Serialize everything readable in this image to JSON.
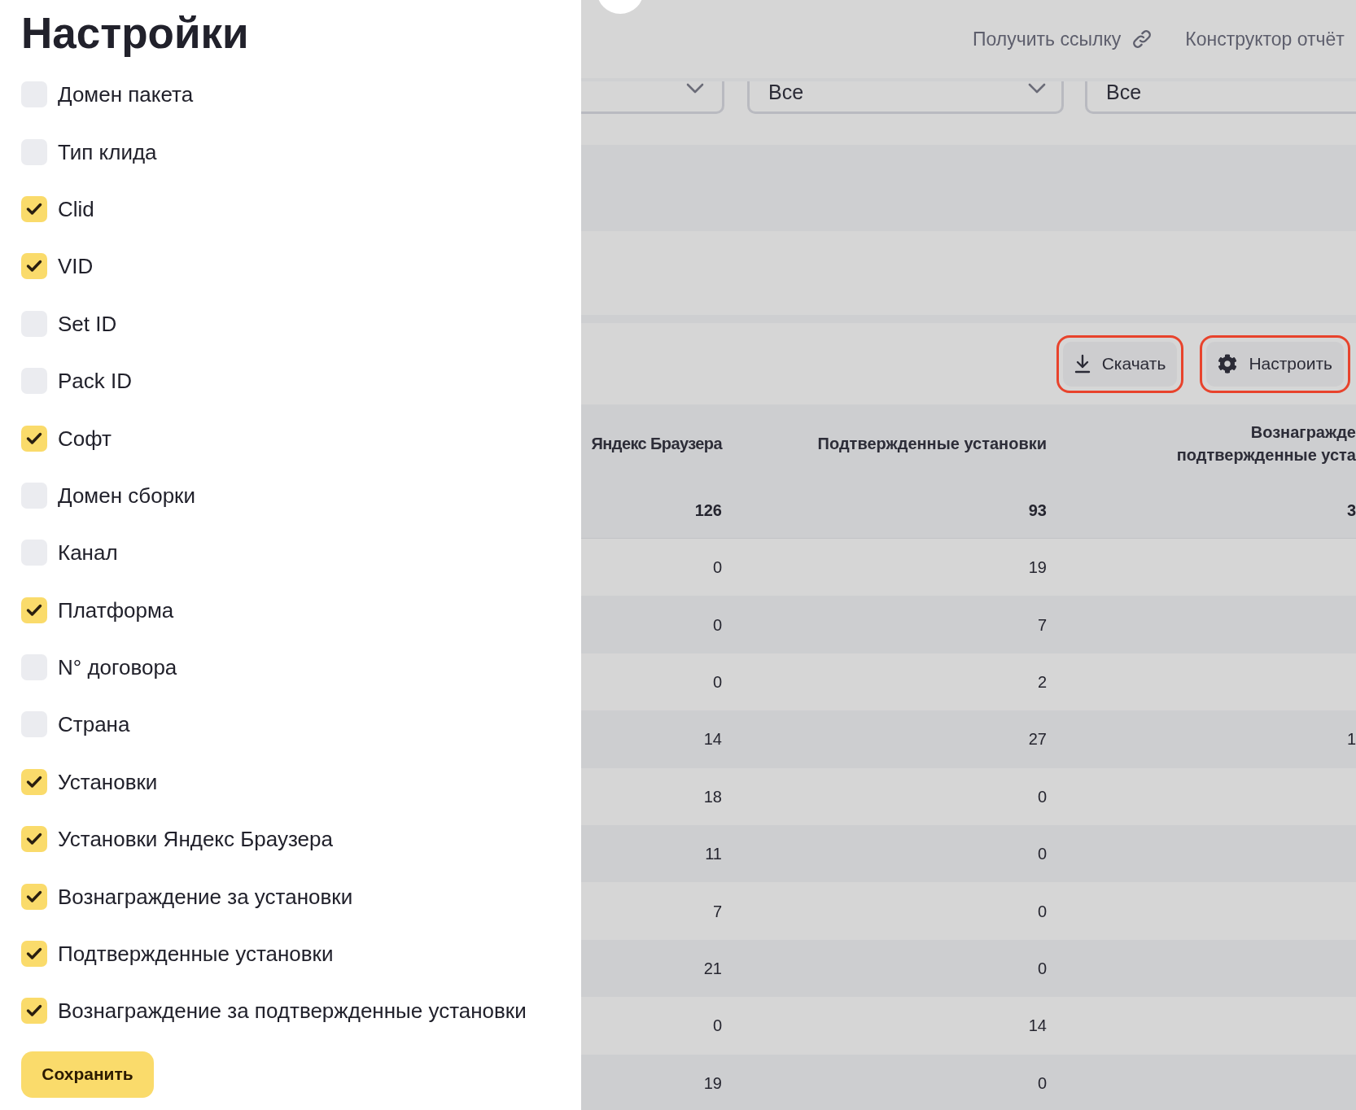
{
  "settings_panel": {
    "title": "Настройки",
    "options": [
      {
        "label": "Домен пакета",
        "checked": false
      },
      {
        "label": "Тип клида",
        "checked": false
      },
      {
        "label": "Clid",
        "checked": true
      },
      {
        "label": "VID",
        "checked": true
      },
      {
        "label": "Set ID",
        "checked": false
      },
      {
        "label": "Pack ID",
        "checked": false
      },
      {
        "label": "Софт",
        "checked": true
      },
      {
        "label": "Домен сборки",
        "checked": false
      },
      {
        "label": "Канал",
        "checked": false
      },
      {
        "label": "Платформа",
        "checked": true
      },
      {
        "label": "N° договора",
        "checked": false
      },
      {
        "label": "Страна",
        "checked": false
      },
      {
        "label": "Установки",
        "checked": true
      },
      {
        "label": "Установки Яндекс Браузера",
        "checked": true
      },
      {
        "label": "Вознаграждение за установки",
        "checked": true
      },
      {
        "label": "Подтвержденные установки",
        "checked": true
      },
      {
        "label": "Вознаграждение за подтвержденные установки",
        "checked": true
      }
    ],
    "save_button": "Сохранить"
  },
  "header": {
    "links": [
      {
        "label": "Получить ссылку",
        "kind": "iconed"
      },
      {
        "label": "Конструктор отчёт",
        "kind": "plain"
      }
    ]
  },
  "filters": [
    {
      "kind": "start"
    },
    {
      "kind": "middle",
      "value": "Все"
    },
    {
      "kind": "end",
      "value": "Все"
    }
  ],
  "toolbar": {
    "buttons": [
      {
        "label": "Скачать",
        "kind": "download",
        "highlighted": true
      },
      {
        "label": "Настроить",
        "kind": "settings",
        "highlighted": true
      }
    ]
  },
  "table": {
    "columns": [
      {
        "label_lines": [
          "Яндекс Браузера"
        ]
      },
      {
        "label_lines": [
          "Подтвержденные установки"
        ]
      },
      {
        "label_lines": [
          "Вознагражде",
          "подтвержденные уста"
        ]
      }
    ],
    "total_row": {
      "cells": [
        "126",
        "93",
        "3"
      ]
    },
    "rows": [
      {
        "cells": [
          "0",
          "19"
        ]
      },
      {
        "cells": [
          "0",
          "7"
        ]
      },
      {
        "cells": [
          "0",
          "2"
        ]
      },
      {
        "cells": [
          "14",
          "27",
          "1"
        ]
      },
      {
        "cells": [
          "18",
          "0"
        ]
      },
      {
        "cells": [
          "11",
          "0"
        ]
      },
      {
        "cells": [
          "7",
          "0"
        ]
      },
      {
        "cells": [
          "21",
          "0"
        ]
      },
      {
        "cells": [
          "0",
          "14"
        ]
      },
      {
        "cells": [
          "19",
          "0"
        ]
      }
    ]
  }
}
